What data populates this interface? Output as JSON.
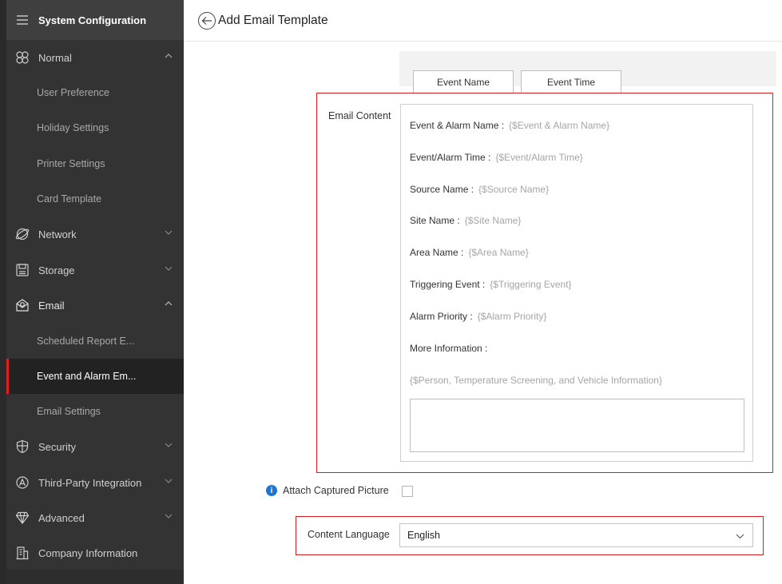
{
  "sidebar": {
    "header_title": "System Configuration",
    "groups": {
      "normal": "Normal",
      "network": "Network",
      "storage": "Storage",
      "email": "Email",
      "security": "Security",
      "third_party": "Third-Party Integration",
      "advanced": "Advanced",
      "company": "Company Information"
    },
    "normal_items": [
      "User Preference",
      "Holiday Settings",
      "Printer Settings",
      "Card Template"
    ],
    "email_items": [
      "Scheduled Report E...",
      "Event and Alarm Em...",
      "Email Settings"
    ]
  },
  "header": {
    "title": "Add Email Template"
  },
  "variables": {
    "event_name": "Event Name",
    "event_time": "Event Time"
  },
  "email_content": {
    "label": "Email Content",
    "rows": [
      {
        "name": "Event & Alarm Name :",
        "value": "{$Event & Alarm Name}"
      },
      {
        "name": "Event/Alarm Time :",
        "value": "{$Event/Alarm Time}"
      },
      {
        "name": "Source Name :",
        "value": "{$Source Name}"
      },
      {
        "name": "Site Name :",
        "value": "{$Site Name}"
      },
      {
        "name": "Area Name :",
        "value": "{$Area Name}"
      },
      {
        "name": "Triggering Event :",
        "value": "{$Triggering Event}"
      },
      {
        "name": "Alarm Priority :",
        "value": "{$Alarm Priority}"
      },
      {
        "name": "More Information :",
        "value": ""
      }
    ],
    "more_info_placeholder": "{$Person, Temperature Screening, and Vehicle Information}"
  },
  "attach_picture": {
    "label": "Attach Captured Picture",
    "checked": false
  },
  "content_language": {
    "label": "Content Language",
    "value": "English"
  },
  "colors": {
    "sidebar_bg": "#333333",
    "active_bar": "#e02020",
    "highlight_border": "#d81e1e",
    "info_blue": "#1e76d3"
  }
}
